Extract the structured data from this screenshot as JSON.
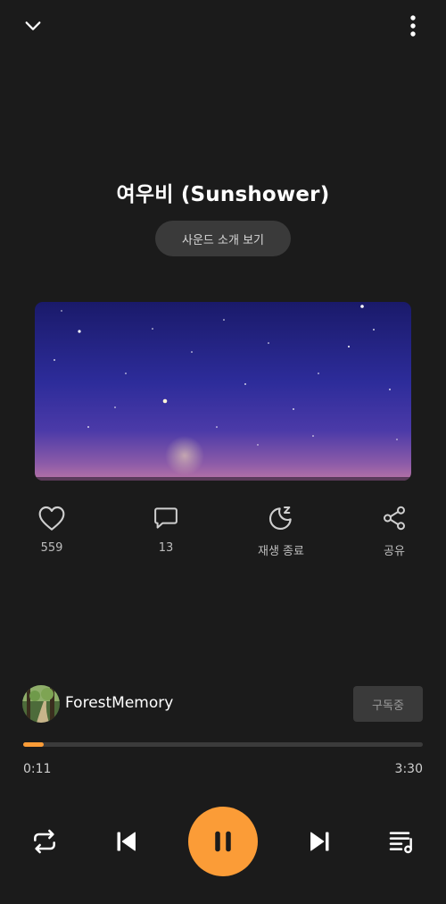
{
  "header": {
    "collapse_icon": "chevron-down-icon",
    "more_icon": "more-vertical-icon"
  },
  "track": {
    "title": "여우비 (Sunshower)",
    "intro_button_label": "사운드 소개 보기"
  },
  "actions": {
    "like": {
      "icon": "heart-icon",
      "label": "559"
    },
    "comment": {
      "icon": "comment-icon",
      "label": "13"
    },
    "sleep_timer": {
      "icon": "moon-sleep-icon",
      "label": "재생 종료"
    },
    "share": {
      "icon": "share-icon",
      "label": "공유"
    }
  },
  "channel": {
    "name": "ForestMemory",
    "subscribe_label": "구독중"
  },
  "playback": {
    "current_time": "0:11",
    "total_time": "3:30",
    "progress_fraction": 0.052
  },
  "controls": {
    "repeat_icon": "repeat-icon",
    "prev_icon": "skip-previous-icon",
    "play_pause_icon": "pause-icon",
    "next_icon": "skip-next-icon",
    "queue_icon": "playlist-icon"
  },
  "colors": {
    "background": "#1b1b1b",
    "accent": "#fb9c37",
    "pill": "#3a3a3a"
  }
}
